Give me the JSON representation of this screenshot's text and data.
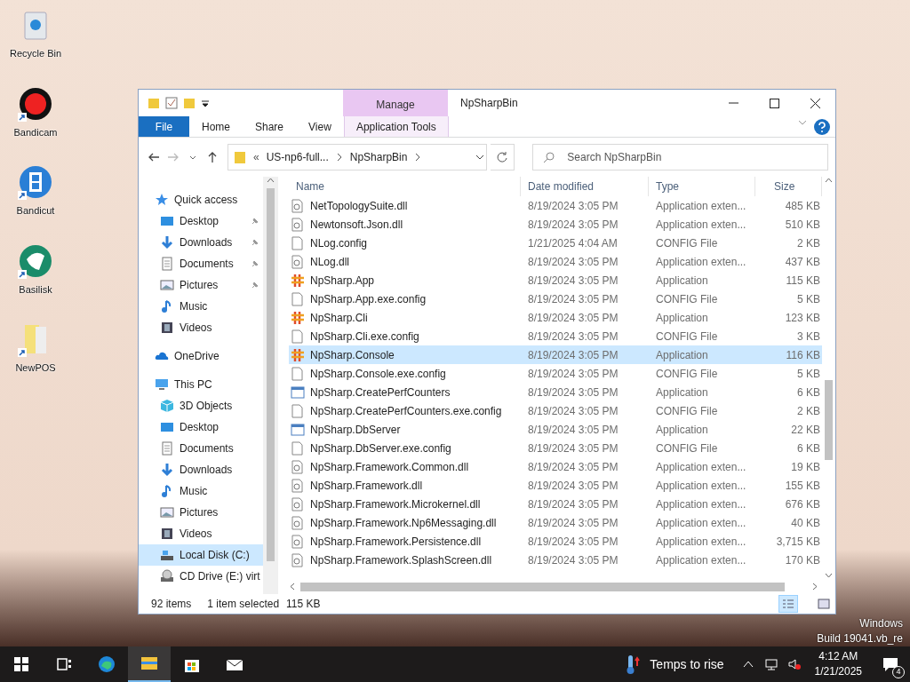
{
  "desktop_icons": [
    {
      "label": "Recycle Bin",
      "kind": "recycle",
      "shortcut": false
    },
    {
      "label": "Bandicam",
      "kind": "record",
      "shortcut": true
    },
    {
      "label": "Bandicut",
      "kind": "film",
      "shortcut": true
    },
    {
      "label": "Basilisk",
      "kind": "basilisk",
      "shortcut": true
    },
    {
      "label": "NewPOS",
      "kind": "folder",
      "shortcut": true
    }
  ],
  "window": {
    "title": "NpSharpBin",
    "context_tab_group": "Manage",
    "ribbon_tabs": [
      {
        "label": "File",
        "kind": "file"
      },
      {
        "label": "Home",
        "kind": "tab"
      },
      {
        "label": "Share",
        "kind": "tab"
      },
      {
        "label": "View",
        "kind": "tab"
      },
      {
        "label": "Application Tools",
        "kind": "context"
      }
    ],
    "address": {
      "overflow": "«",
      "path": [
        {
          "label": "US-np6-full..."
        },
        {
          "label": "NpSharpBin"
        }
      ]
    },
    "search": {
      "placeholder": "Search NpSharpBin"
    },
    "nav": [
      {
        "label": "Quick access",
        "kind": "star",
        "selected": false,
        "children": [
          {
            "label": "Desktop",
            "kind": "desktop",
            "pinned": true,
            "selected": false
          },
          {
            "label": "Downloads",
            "kind": "download",
            "pinned": true,
            "selected": false
          },
          {
            "label": "Documents",
            "kind": "document",
            "pinned": true,
            "selected": false
          },
          {
            "label": "Pictures",
            "kind": "picture",
            "pinned": true,
            "selected": false
          },
          {
            "label": "Music",
            "kind": "music",
            "pinned": false,
            "selected": false
          },
          {
            "label": "Videos",
            "kind": "video",
            "pinned": false,
            "selected": false
          }
        ]
      },
      {
        "label": "OneDrive",
        "kind": "cloud",
        "selected": false
      },
      {
        "label": "This PC",
        "kind": "pc",
        "selected": false,
        "children": [
          {
            "label": "3D Objects",
            "kind": "cube",
            "pinned": false,
            "selected": false
          },
          {
            "label": "Desktop",
            "kind": "desktop",
            "pinned": false,
            "selected": false
          },
          {
            "label": "Documents",
            "kind": "document",
            "pinned": false,
            "selected": false
          },
          {
            "label": "Downloads",
            "kind": "download",
            "pinned": false,
            "selected": false
          },
          {
            "label": "Music",
            "kind": "music",
            "pinned": false,
            "selected": false
          },
          {
            "label": "Pictures",
            "kind": "picture",
            "pinned": false,
            "selected": false
          },
          {
            "label": "Videos",
            "kind": "video",
            "pinned": false,
            "selected": false
          },
          {
            "label": "Local Disk (C:)",
            "kind": "disk",
            "pinned": false,
            "selected": true
          },
          {
            "label": "CD Drive (E:) virt",
            "kind": "cd",
            "pinned": false,
            "selected": false
          }
        ]
      }
    ],
    "columns": [
      "Name",
      "Date modified",
      "Type",
      "Size"
    ],
    "files": [
      {
        "name": "NetTopologySuite.dll",
        "kind": "dll",
        "date": "8/19/2024 3:05 PM",
        "type": "Application exten...",
        "size": "485 KB",
        "selected": false
      },
      {
        "name": "Newtonsoft.Json.dll",
        "kind": "dll",
        "date": "8/19/2024 3:05 PM",
        "type": "Application exten...",
        "size": "510 KB",
        "selected": false
      },
      {
        "name": "NLog.config",
        "kind": "config",
        "date": "1/21/2025 4:04 AM",
        "type": "CONFIG File",
        "size": "2 KB",
        "selected": false
      },
      {
        "name": "NLog.dll",
        "kind": "dll",
        "date": "8/19/2024 3:05 PM",
        "type": "Application exten...",
        "size": "437 KB",
        "selected": false
      },
      {
        "name": "NpSharp.App",
        "kind": "hash",
        "date": "8/19/2024 3:05 PM",
        "type": "Application",
        "size": "115 KB",
        "selected": false
      },
      {
        "name": "NpSharp.App.exe.config",
        "kind": "config",
        "date": "8/19/2024 3:05 PM",
        "type": "CONFIG File",
        "size": "5 KB",
        "selected": false
      },
      {
        "name": "NpSharp.Cli",
        "kind": "hash",
        "date": "8/19/2024 3:05 PM",
        "type": "Application",
        "size": "123 KB",
        "selected": false
      },
      {
        "name": "NpSharp.Cli.exe.config",
        "kind": "config",
        "date": "8/19/2024 3:05 PM",
        "type": "CONFIG File",
        "size": "3 KB",
        "selected": false
      },
      {
        "name": "NpSharp.Console",
        "kind": "hash",
        "date": "8/19/2024 3:05 PM",
        "type": "Application",
        "size": "116 KB",
        "selected": true
      },
      {
        "name": "NpSharp.Console.exe.config",
        "kind": "config",
        "date": "8/19/2024 3:05 PM",
        "type": "CONFIG File",
        "size": "5 KB",
        "selected": false
      },
      {
        "name": "NpSharp.CreatePerfCounters",
        "kind": "exe",
        "date": "8/19/2024 3:05 PM",
        "type": "Application",
        "size": "6 KB",
        "selected": false
      },
      {
        "name": "NpSharp.CreatePerfCounters.exe.config",
        "kind": "config",
        "date": "8/19/2024 3:05 PM",
        "type": "CONFIG File",
        "size": "2 KB",
        "selected": false
      },
      {
        "name": "NpSharp.DbServer",
        "kind": "exe",
        "date": "8/19/2024 3:05 PM",
        "type": "Application",
        "size": "22 KB",
        "selected": false
      },
      {
        "name": "NpSharp.DbServer.exe.config",
        "kind": "config",
        "date": "8/19/2024 3:05 PM",
        "type": "CONFIG File",
        "size": "6 KB",
        "selected": false
      },
      {
        "name": "NpSharp.Framework.Common.dll",
        "kind": "dll",
        "date": "8/19/2024 3:05 PM",
        "type": "Application exten...",
        "size": "19 KB",
        "selected": false
      },
      {
        "name": "NpSharp.Framework.dll",
        "kind": "dll",
        "date": "8/19/2024 3:05 PM",
        "type": "Application exten...",
        "size": "155 KB",
        "selected": false
      },
      {
        "name": "NpSharp.Framework.Microkernel.dll",
        "kind": "dll",
        "date": "8/19/2024 3:05 PM",
        "type": "Application exten...",
        "size": "676 KB",
        "selected": false
      },
      {
        "name": "NpSharp.Framework.Np6Messaging.dll",
        "kind": "dll",
        "date": "8/19/2024 3:05 PM",
        "type": "Application exten...",
        "size": "40 KB",
        "selected": false
      },
      {
        "name": "NpSharp.Framework.Persistence.dll",
        "kind": "dll",
        "date": "8/19/2024 3:05 PM",
        "type": "Application exten...",
        "size": "3,715 KB",
        "selected": false
      },
      {
        "name": "NpSharp.Framework.SplashScreen.dll",
        "kind": "dll",
        "date": "8/19/2024 3:05 PM",
        "type": "Application exten...",
        "size": "170 KB",
        "selected": false
      }
    ],
    "status": {
      "items": "92 items",
      "selection": "1 item selected",
      "selection_size": "115 KB"
    }
  },
  "activation_notice": [
    "Windows",
    "Build 19041.vb_re"
  ],
  "taskbar": {
    "apps": [
      {
        "kind": "start",
        "active": false
      },
      {
        "kind": "taskview",
        "active": false
      },
      {
        "kind": "edge",
        "active": false
      },
      {
        "kind": "explorer",
        "active": true
      },
      {
        "kind": "store",
        "active": false
      },
      {
        "kind": "mail",
        "active": false
      }
    ],
    "weather": "Temps to rise",
    "time": "4:12 AM",
    "date": "1/21/2025",
    "notifications": "4"
  }
}
